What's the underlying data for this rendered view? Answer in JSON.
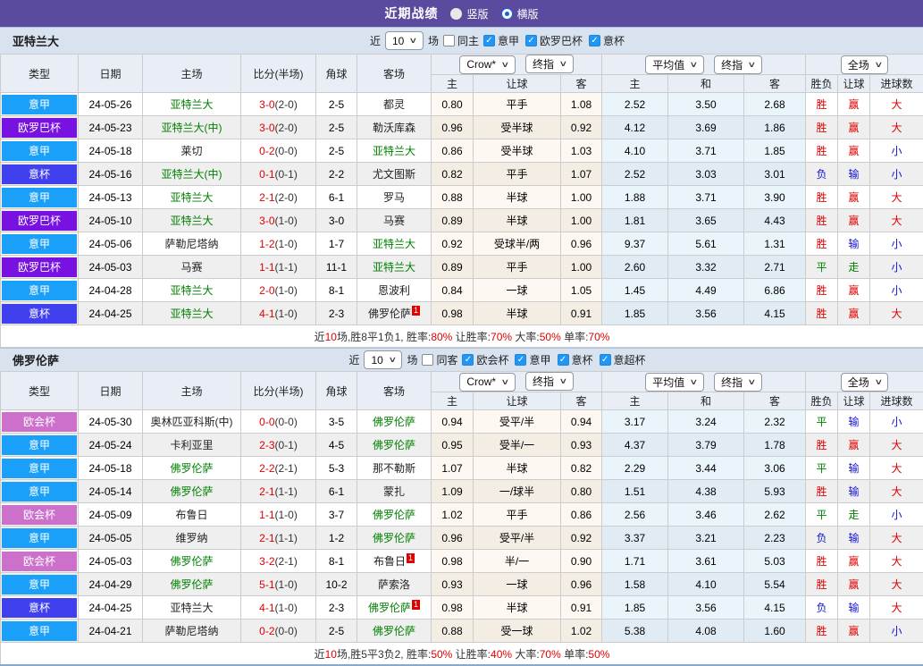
{
  "title_bar": {
    "title": "近期战绩",
    "radios": [
      {
        "label": "竖版",
        "selected": false
      },
      {
        "label": "横版",
        "selected": true
      }
    ]
  },
  "palette": {
    "title_bar_bg": "#5b4a9e",
    "section_bar_bg": "#d9e3f0",
    "table_header_bg": "#e9eef6",
    "red": "#e10000",
    "blue": "#1414d2",
    "green": "#008000",
    "team_green": "#008000",
    "league_colors": {
      "意甲": "#1aa0f8",
      "欧罗巴杯": "#7712e0",
      "意杯": "#4040ee",
      "欧会杯": "#cc70cc"
    }
  },
  "table_header": {
    "cols": [
      "类型",
      "日期",
      "主场",
      "比分(半场)",
      "角球",
      "客场"
    ],
    "group1": {
      "dd1": "Crow*",
      "dd2": "终指",
      "subs": [
        "主",
        "让球",
        "客"
      ]
    },
    "group2": {
      "dd1": "平均值",
      "dd2": "终指",
      "subs": [
        "主",
        "和",
        "客"
      ]
    },
    "group3": {
      "dd1": "全场",
      "subs": [
        "胜负",
        "让球",
        "进球数"
      ]
    }
  },
  "sections": [
    {
      "team": "亚特兰大",
      "filter": {
        "prefix": "近",
        "count": "10",
        "suffix": "场",
        "same_label": "同主",
        "same_checked": false,
        "leagues": [
          {
            "label": "意甲",
            "checked": true
          },
          {
            "label": "欧罗巴杯",
            "checked": true
          },
          {
            "label": "意杯",
            "checked": true
          }
        ]
      },
      "rows": [
        {
          "league": "意甲",
          "date": "24-05-26",
          "home": "亚特兰大",
          "home_green": true,
          "home_sup": "",
          "score": "3-0",
          "half": "(2-0)",
          "corner": "2-5",
          "away": "都灵",
          "away_green": false,
          "away_sup": "",
          "let_home": "0.80",
          "handicap": "平手",
          "let_away": "1.08",
          "avg_home": "2.52",
          "avg_draw": "3.50",
          "avg_away": "2.68",
          "wdl": "胜",
          "wdl_color": "red",
          "let_res": "赢",
          "let_res_color": "red",
          "goal_res": "大",
          "goal_res_color": "red"
        },
        {
          "league": "欧罗巴杯",
          "date": "24-05-23",
          "home": "亚特兰大(中)",
          "home_green": true,
          "home_sup": "",
          "score": "3-0",
          "half": "(2-0)",
          "corner": "2-5",
          "away": "勒沃库森",
          "away_green": false,
          "away_sup": "",
          "let_home": "0.96",
          "handicap": "受半球",
          "let_away": "0.92",
          "avg_home": "4.12",
          "avg_draw": "3.69",
          "avg_away": "1.86",
          "wdl": "胜",
          "wdl_color": "red",
          "let_res": "赢",
          "let_res_color": "red",
          "goal_res": "大",
          "goal_res_color": "red"
        },
        {
          "league": "意甲",
          "date": "24-05-18",
          "home": "莱切",
          "home_green": false,
          "home_sup": "",
          "score": "0-2",
          "half": "(0-0)",
          "corner": "2-5",
          "away": "亚特兰大",
          "away_green": true,
          "away_sup": "",
          "let_home": "0.86",
          "handicap": "受半球",
          "let_away": "1.03",
          "avg_home": "4.10",
          "avg_draw": "3.71",
          "avg_away": "1.85",
          "wdl": "胜",
          "wdl_color": "red",
          "let_res": "赢",
          "let_res_color": "red",
          "goal_res": "小",
          "goal_res_color": "blue"
        },
        {
          "league": "意杯",
          "date": "24-05-16",
          "home": "亚特兰大(中)",
          "home_green": true,
          "home_sup": "",
          "score": "0-1",
          "half": "(0-1)",
          "corner": "2-2",
          "away": "尤文图斯",
          "away_green": false,
          "away_sup": "",
          "let_home": "0.82",
          "handicap": "平手",
          "let_away": "1.07",
          "avg_home": "2.52",
          "avg_draw": "3.03",
          "avg_away": "3.01",
          "wdl": "负",
          "wdl_color": "blue",
          "let_res": "输",
          "let_res_color": "blue",
          "goal_res": "小",
          "goal_res_color": "blue"
        },
        {
          "league": "意甲",
          "date": "24-05-13",
          "home": "亚特兰大",
          "home_green": true,
          "home_sup": "",
          "score": "2-1",
          "half": "(2-0)",
          "corner": "6-1",
          "away": "罗马",
          "away_green": false,
          "away_sup": "",
          "let_home": "0.88",
          "handicap": "半球",
          "let_away": "1.00",
          "avg_home": "1.88",
          "avg_draw": "3.71",
          "avg_away": "3.90",
          "wdl": "胜",
          "wdl_color": "red",
          "let_res": "赢",
          "let_res_color": "red",
          "goal_res": "大",
          "goal_res_color": "red"
        },
        {
          "league": "欧罗巴杯",
          "date": "24-05-10",
          "home": "亚特兰大",
          "home_green": true,
          "home_sup": "",
          "score": "3-0",
          "half": "(1-0)",
          "corner": "3-0",
          "away": "马赛",
          "away_green": false,
          "away_sup": "",
          "let_home": "0.89",
          "handicap": "半球",
          "let_away": "1.00",
          "avg_home": "1.81",
          "avg_draw": "3.65",
          "avg_away": "4.43",
          "wdl": "胜",
          "wdl_color": "red",
          "let_res": "赢",
          "let_res_color": "red",
          "goal_res": "大",
          "goal_res_color": "red"
        },
        {
          "league": "意甲",
          "date": "24-05-06",
          "home": "萨勒尼塔纳",
          "home_green": false,
          "home_sup": "",
          "score": "1-2",
          "half": "(1-0)",
          "corner": "1-7",
          "away": "亚特兰大",
          "away_green": true,
          "away_sup": "",
          "let_home": "0.92",
          "handicap": "受球半/两",
          "let_away": "0.96",
          "avg_home": "9.37",
          "avg_draw": "5.61",
          "avg_away": "1.31",
          "wdl": "胜",
          "wdl_color": "red",
          "let_res": "输",
          "let_res_color": "blue",
          "goal_res": "小",
          "goal_res_color": "blue"
        },
        {
          "league": "欧罗巴杯",
          "date": "24-05-03",
          "home": "马赛",
          "home_green": false,
          "home_sup": "",
          "score": "1-1",
          "half": "(1-1)",
          "corner": "11-1",
          "away": "亚特兰大",
          "away_green": true,
          "away_sup": "",
          "let_home": "0.89",
          "handicap": "平手",
          "let_away": "1.00",
          "avg_home": "2.60",
          "avg_draw": "3.32",
          "avg_away": "2.71",
          "wdl": "平",
          "wdl_color": "green",
          "let_res": "走",
          "let_res_color": "green",
          "goal_res": "小",
          "goal_res_color": "blue"
        },
        {
          "league": "意甲",
          "date": "24-04-28",
          "home": "亚特兰大",
          "home_green": true,
          "home_sup": "",
          "score": "2-0",
          "half": "(1-0)",
          "corner": "8-1",
          "away": "恩波利",
          "away_green": false,
          "away_sup": "",
          "let_home": "0.84",
          "handicap": "一球",
          "let_away": "1.05",
          "avg_home": "1.45",
          "avg_draw": "4.49",
          "avg_away": "6.86",
          "wdl": "胜",
          "wdl_color": "red",
          "let_res": "赢",
          "let_res_color": "red",
          "goal_res": "小",
          "goal_res_color": "blue"
        },
        {
          "league": "意杯",
          "date": "24-04-25",
          "home": "亚特兰大",
          "home_green": true,
          "home_sup": "",
          "score": "4-1",
          "half": "(1-0)",
          "corner": "2-3",
          "away": "佛罗伦萨",
          "away_green": false,
          "away_sup": "1",
          "let_home": "0.98",
          "handicap": "半球",
          "let_away": "0.91",
          "avg_home": "1.85",
          "avg_draw": "3.56",
          "avg_away": "4.15",
          "wdl": "胜",
          "wdl_color": "red",
          "let_res": "赢",
          "let_res_color": "red",
          "goal_res": "大",
          "goal_res_color": "red"
        }
      ],
      "summary": [
        {
          "text": "近"
        },
        {
          "text": "10",
          "red": true
        },
        {
          "text": "场,胜8平1负1, 胜率:"
        },
        {
          "text": "80%",
          "red": true
        },
        {
          "text": " 让胜率:"
        },
        {
          "text": "70%",
          "red": true
        },
        {
          "text": " 大率:"
        },
        {
          "text": "50%",
          "red": true
        },
        {
          "text": " 单率:"
        },
        {
          "text": "70%",
          "red": true
        }
      ]
    },
    {
      "team": "佛罗伦萨",
      "filter": {
        "prefix": "近",
        "count": "10",
        "suffix": "场",
        "same_label": "同客",
        "same_checked": false,
        "leagues": [
          {
            "label": "欧会杯",
            "checked": true
          },
          {
            "label": "意甲",
            "checked": true
          },
          {
            "label": "意杯",
            "checked": true
          },
          {
            "label": "意超杯",
            "checked": true
          }
        ]
      },
      "rows": [
        {
          "league": "欧会杯",
          "date": "24-05-30",
          "home": "奥林匹亚科斯(中)",
          "home_green": false,
          "home_sup": "",
          "score": "0-0",
          "half": "(0-0)",
          "corner": "3-5",
          "away": "佛罗伦萨",
          "away_green": true,
          "away_sup": "",
          "let_home": "0.94",
          "handicap": "受平/半",
          "let_away": "0.94",
          "avg_home": "3.17",
          "avg_draw": "3.24",
          "avg_away": "2.32",
          "wdl": "平",
          "wdl_color": "green",
          "let_res": "输",
          "let_res_color": "blue",
          "goal_res": "小",
          "goal_res_color": "blue"
        },
        {
          "league": "意甲",
          "date": "24-05-24",
          "home": "卡利亚里",
          "home_green": false,
          "home_sup": "",
          "score": "2-3",
          "half": "(0-1)",
          "corner": "4-5",
          "away": "佛罗伦萨",
          "away_green": true,
          "away_sup": "",
          "let_home": "0.95",
          "handicap": "受半/一",
          "let_away": "0.93",
          "avg_home": "4.37",
          "avg_draw": "3.79",
          "avg_away": "1.78",
          "wdl": "胜",
          "wdl_color": "red",
          "let_res": "赢",
          "let_res_color": "red",
          "goal_res": "大",
          "goal_res_color": "red"
        },
        {
          "league": "意甲",
          "date": "24-05-18",
          "home": "佛罗伦萨",
          "home_green": true,
          "home_sup": "",
          "score": "2-2",
          "half": "(2-1)",
          "corner": "5-3",
          "away": "那不勒斯",
          "away_green": false,
          "away_sup": "",
          "let_home": "1.07",
          "handicap": "半球",
          "let_away": "0.82",
          "avg_home": "2.29",
          "avg_draw": "3.44",
          "avg_away": "3.06",
          "wdl": "平",
          "wdl_color": "green",
          "let_res": "输",
          "let_res_color": "blue",
          "goal_res": "大",
          "goal_res_color": "red"
        },
        {
          "league": "意甲",
          "date": "24-05-14",
          "home": "佛罗伦萨",
          "home_green": true,
          "home_sup": "",
          "score": "2-1",
          "half": "(1-1)",
          "corner": "6-1",
          "away": "蒙扎",
          "away_green": false,
          "away_sup": "",
          "let_home": "1.09",
          "handicap": "一/球半",
          "let_away": "0.80",
          "avg_home": "1.51",
          "avg_draw": "4.38",
          "avg_away": "5.93",
          "wdl": "胜",
          "wdl_color": "red",
          "let_res": "输",
          "let_res_color": "blue",
          "goal_res": "大",
          "goal_res_color": "red"
        },
        {
          "league": "欧会杯",
          "date": "24-05-09",
          "home": "布鲁日",
          "home_green": false,
          "home_sup": "",
          "score": "1-1",
          "half": "(1-0)",
          "corner": "3-7",
          "away": "佛罗伦萨",
          "away_green": true,
          "away_sup": "",
          "let_home": "1.02",
          "handicap": "平手",
          "let_away": "0.86",
          "avg_home": "2.56",
          "avg_draw": "3.46",
          "avg_away": "2.62",
          "wdl": "平",
          "wdl_color": "green",
          "let_res": "走",
          "let_res_color": "green",
          "goal_res": "小",
          "goal_res_color": "blue"
        },
        {
          "league": "意甲",
          "date": "24-05-05",
          "home": "维罗纳",
          "home_green": false,
          "home_sup": "",
          "score": "2-1",
          "half": "(1-1)",
          "corner": "1-2",
          "away": "佛罗伦萨",
          "away_green": true,
          "away_sup": "",
          "let_home": "0.96",
          "handicap": "受平/半",
          "let_away": "0.92",
          "avg_home": "3.37",
          "avg_draw": "3.21",
          "avg_away": "2.23",
          "wdl": "负",
          "wdl_color": "blue",
          "let_res": "输",
          "let_res_color": "blue",
          "goal_res": "大",
          "goal_res_color": "red"
        },
        {
          "league": "欧会杯",
          "date": "24-05-03",
          "home": "佛罗伦萨",
          "home_green": true,
          "home_sup": "",
          "score": "3-2",
          "half": "(2-1)",
          "corner": "8-1",
          "away": "布鲁日",
          "away_green": false,
          "away_sup": "1",
          "let_home": "0.98",
          "handicap": "半/一",
          "let_away": "0.90",
          "avg_home": "1.71",
          "avg_draw": "3.61",
          "avg_away": "5.03",
          "wdl": "胜",
          "wdl_color": "red",
          "let_res": "赢",
          "let_res_color": "red",
          "goal_res": "大",
          "goal_res_color": "red"
        },
        {
          "league": "意甲",
          "date": "24-04-29",
          "home": "佛罗伦萨",
          "home_green": true,
          "home_sup": "",
          "score": "5-1",
          "half": "(1-0)",
          "corner": "10-2",
          "away": "萨索洛",
          "away_green": false,
          "away_sup": "",
          "let_home": "0.93",
          "handicap": "一球",
          "let_away": "0.96",
          "avg_home": "1.58",
          "avg_draw": "4.10",
          "avg_away": "5.54",
          "wdl": "胜",
          "wdl_color": "red",
          "let_res": "赢",
          "let_res_color": "red",
          "goal_res": "大",
          "goal_res_color": "red"
        },
        {
          "league": "意杯",
          "date": "24-04-25",
          "home": "亚特兰大",
          "home_green": false,
          "home_sup": "",
          "score": "4-1",
          "half": "(1-0)",
          "corner": "2-3",
          "away": "佛罗伦萨",
          "away_green": true,
          "away_sup": "1",
          "let_home": "0.98",
          "handicap": "半球",
          "let_away": "0.91",
          "avg_home": "1.85",
          "avg_draw": "3.56",
          "avg_away": "4.15",
          "wdl": "负",
          "wdl_color": "blue",
          "let_res": "输",
          "let_res_color": "blue",
          "goal_res": "大",
          "goal_res_color": "red"
        },
        {
          "league": "意甲",
          "date": "24-04-21",
          "home": "萨勒尼塔纳",
          "home_green": false,
          "home_sup": "",
          "score": "0-2",
          "half": "(0-0)",
          "corner": "2-5",
          "away": "佛罗伦萨",
          "away_green": true,
          "away_sup": "",
          "let_home": "0.88",
          "handicap": "受一球",
          "let_away": "1.02",
          "avg_home": "5.38",
          "avg_draw": "4.08",
          "avg_away": "1.60",
          "wdl": "胜",
          "wdl_color": "red",
          "let_res": "赢",
          "let_res_color": "red",
          "goal_res": "小",
          "goal_res_color": "blue"
        }
      ],
      "summary": [
        {
          "text": "近"
        },
        {
          "text": "10",
          "red": true
        },
        {
          "text": "场,胜5平3负2, 胜率:"
        },
        {
          "text": "50%",
          "red": true
        },
        {
          "text": " 让胜率:"
        },
        {
          "text": "40%",
          "red": true
        },
        {
          "text": " 大率:"
        },
        {
          "text": "70%",
          "red": true
        },
        {
          "text": " 单率:"
        },
        {
          "text": "50%",
          "red": true
        }
      ]
    }
  ]
}
